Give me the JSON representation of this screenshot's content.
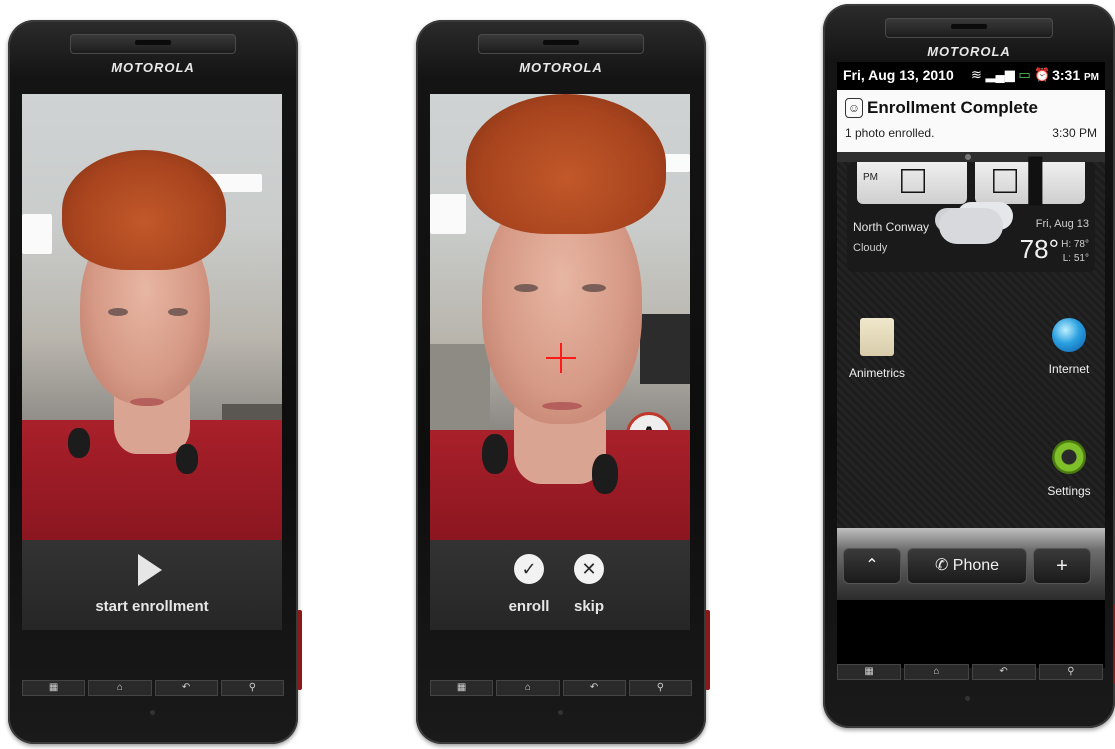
{
  "brand": "MOTOROLA",
  "phone1": {
    "action_label": "start enrollment"
  },
  "phone2": {
    "enroll_label": "enroll",
    "skip_label": "skip"
  },
  "phone3": {
    "status": {
      "date": "Fri, Aug 13, 2010",
      "time": "3:31",
      "time_suffix": "PM"
    },
    "notification": {
      "title": "Enrollment Complete",
      "text": "1 photo enrolled.",
      "time": "3:30 PM"
    },
    "weather": {
      "clock_period": "PM",
      "city": "North Conway",
      "condition": "Cloudy",
      "date": "Fri, Aug 13",
      "temp": "78°",
      "high": "H: 78°",
      "low": "L: 51°"
    },
    "apps": {
      "animetrics": "Animetrics",
      "internet": "Internet",
      "settings": "Settings"
    },
    "dock": {
      "phone_label": "Phone",
      "plus_label": "+"
    }
  },
  "icons": {
    "play": "play-icon",
    "check": "checkmark-icon",
    "close": "close-icon",
    "folder": "folder-icon",
    "globe": "globe-icon",
    "gear": "gear-icon",
    "phone": "phone-handset-icon",
    "menu": "menu-icon",
    "home": "home-icon",
    "back": "back-icon",
    "search": "search-icon"
  },
  "nav_keys": [
    "▦",
    "⌂",
    "↶",
    "⚲"
  ],
  "colors": {
    "crosshair": "#ff1a1a",
    "shirt": "#a9202a",
    "notification_bg": "#fafafa"
  }
}
